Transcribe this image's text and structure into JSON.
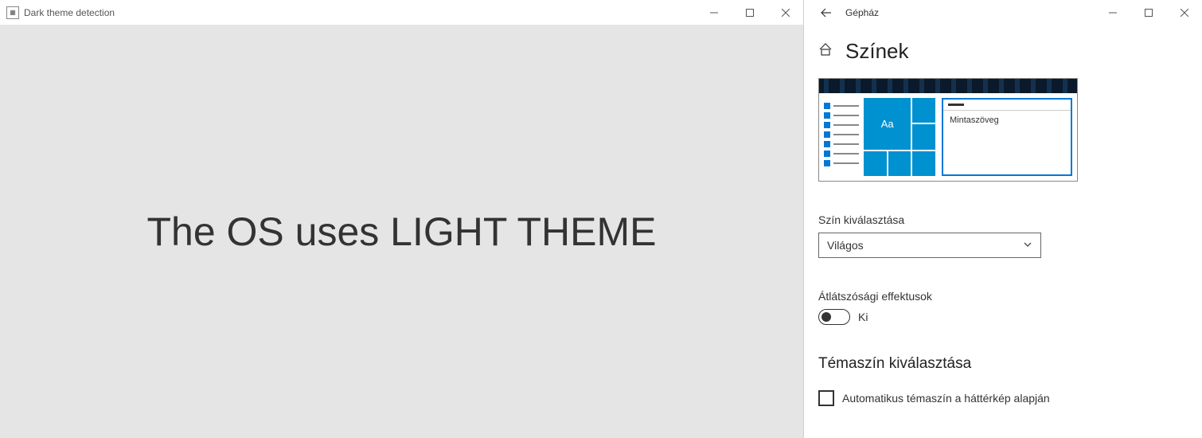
{
  "left": {
    "title": "Dark theme detection",
    "content_text": "The OS uses LIGHT THEME"
  },
  "right": {
    "app_title": "Gépház",
    "page_heading": "Színek",
    "preview": {
      "tile_label": "Aa",
      "sample_text": "Mintaszöveg"
    },
    "color_mode": {
      "label": "Szín kiválasztása",
      "selected": "Világos"
    },
    "transparency": {
      "label": "Átlátszósági effektusok",
      "state": "Ki"
    },
    "accent": {
      "heading": "Témaszín kiválasztása",
      "auto_checkbox_label": "Automatikus témaszín a háttérkép alapján"
    }
  }
}
